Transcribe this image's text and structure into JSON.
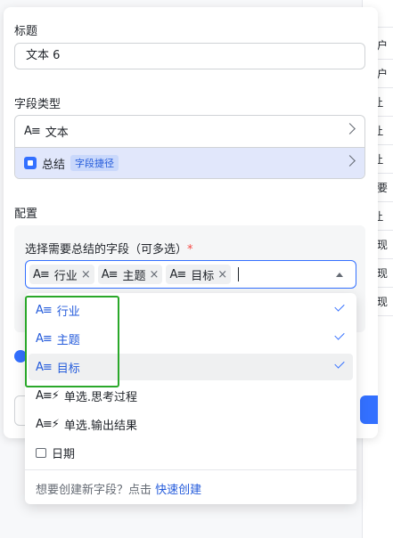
{
  "background_table": {
    "cells": [
      "",
      "用户",
      "用户",
      "P让",
      "P让",
      "P让",
      "户要",
      "P让",
      "我现",
      "我现",
      "我现"
    ]
  },
  "form": {
    "title_label": "标题",
    "title_value": "文本 6",
    "field_type_label": "字段类型",
    "field_types": [
      {
        "icon": "A≡",
        "label": "文本"
      },
      {
        "icon": "ai-summary-icon",
        "label": "总结",
        "tag": "字段捷径"
      }
    ],
    "config_label": "配置",
    "summary_fields_label": "选择需要总结的字段（可多选）",
    "required_mark": "*"
  },
  "selected_chips": [
    {
      "icon": "A≡",
      "label": "行业"
    },
    {
      "icon": "A≡",
      "label": "主题"
    },
    {
      "icon": "A≡",
      "label": "目标"
    }
  ],
  "chip_remove_glyph": "×",
  "dropdown": {
    "options": [
      {
        "icon": "A≡",
        "label": "行业",
        "selected": true
      },
      {
        "icon": "A≡",
        "label": "主题",
        "selected": true
      },
      {
        "icon": "A≡",
        "label": "目标",
        "selected": true
      },
      {
        "icon": "A≡⚡",
        "label": "单选.思考过程",
        "selected": false
      },
      {
        "icon": "A≡⚡",
        "label": "单选.输出结果",
        "selected": false
      },
      {
        "icon": "calendar-icon",
        "label": "日期",
        "selected": false
      }
    ],
    "footer_text": "想要创建新字段？点击",
    "footer_link": "快速创建"
  },
  "colors": {
    "accent": "#3370ff",
    "selected_text": "#245bdb",
    "highlight_outline": "#2aa82a"
  }
}
